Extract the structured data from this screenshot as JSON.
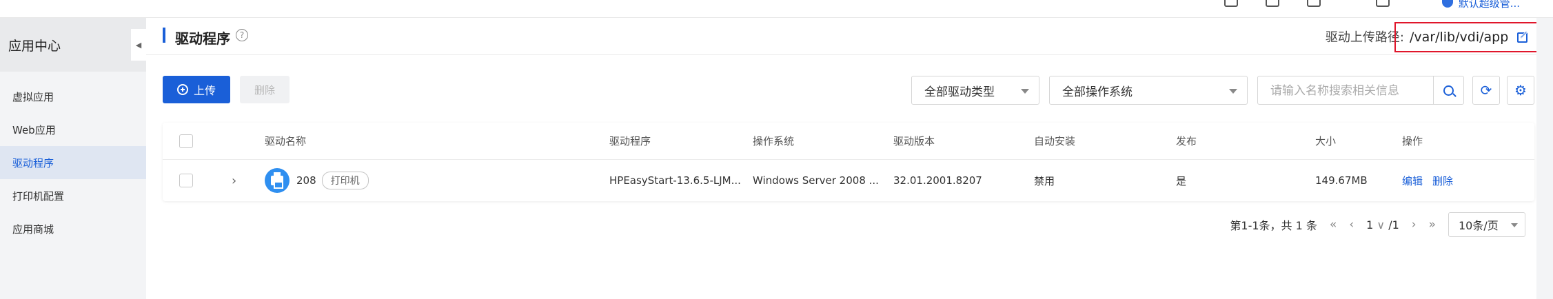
{
  "topbar": {
    "user_label": "默认超级管..."
  },
  "sidebar": {
    "title": "应用中心",
    "items": [
      {
        "label": "虚拟应用",
        "active": false
      },
      {
        "label": "Web应用",
        "active": false
      },
      {
        "label": "驱动程序",
        "active": true
      },
      {
        "label": "打印机配置",
        "active": false
      },
      {
        "label": "应用商城",
        "active": false
      }
    ]
  },
  "header": {
    "title": "驱动程序",
    "help": "?",
    "path_label": "驱动上传路径:",
    "path_value": "/var/lib/vdi/app"
  },
  "toolbar": {
    "upload_label": "上传",
    "delete_label": "删除",
    "type_select": "全部驱动类型",
    "os_select": "全部操作系统",
    "search_placeholder": "请输入名称搜索相关信息"
  },
  "table": {
    "columns": {
      "name": "驱动名称",
      "driver": "驱动程序",
      "os": "操作系统",
      "version": "驱动版本",
      "auto_install": "自动安装",
      "publish": "发布",
      "size": "大小",
      "actions": "操作"
    },
    "rows": [
      {
        "name": "208",
        "tag": "打印机",
        "driver": "HPEasyStart-13.6.5-LJM...",
        "os": "Windows Server 2008 ...",
        "version": "32.01.2001.8207",
        "auto_install": "禁用",
        "publish": "是",
        "size": "149.67MB",
        "edit": "编辑",
        "delete": "删除"
      }
    ]
  },
  "pagination": {
    "summary": "第1-1条，共 1 条",
    "first": "«",
    "prev": "‹",
    "current": "1",
    "total": "/1",
    "next": "›",
    "last": "»",
    "page_size": "10条/页"
  },
  "colors": {
    "primary": "#1a5fd8",
    "highlight_border": "#e0162b"
  }
}
